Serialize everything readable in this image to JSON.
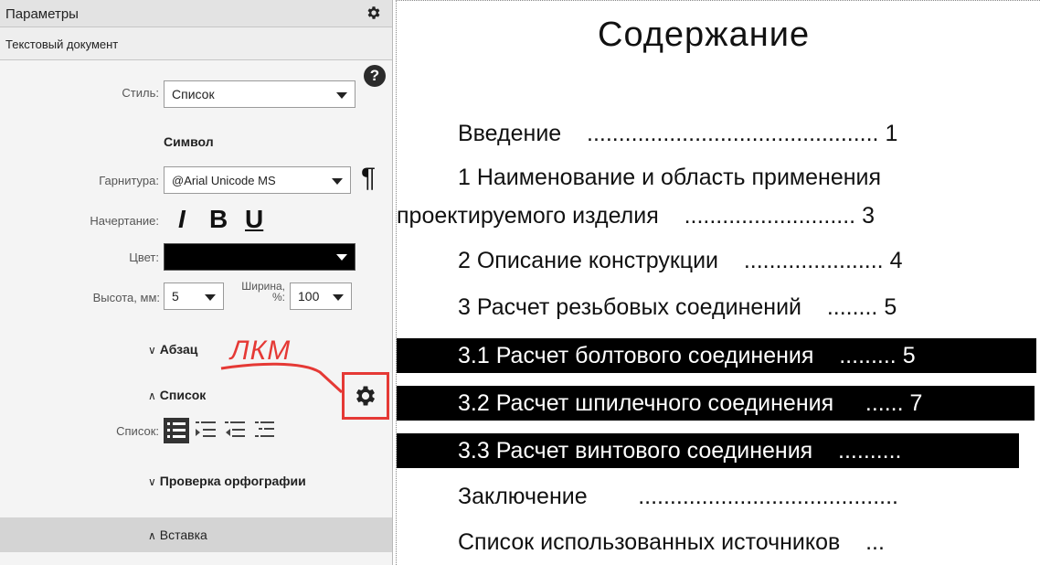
{
  "panel": {
    "title": "Параметры",
    "subtitle": "Текстовый документ",
    "help_label": "?",
    "style_label": "Стиль:",
    "style_value": "Список",
    "symbol_section": "Символ",
    "font_label": "Гарнитура:",
    "font_value": "@Arial Unicode MS",
    "paragraph_mark": "¶",
    "style_face_label": "Начертание:",
    "italic_label": "I",
    "bold_label": "B",
    "underline_label": "U",
    "color_label": "Цвет:",
    "color_value": "#000000",
    "height_label": "Высота, мм:",
    "height_value": "5",
    "width_label": "Ширина, %:",
    "width_value": "100",
    "sections": {
      "paragraph": "Абзац",
      "list": "Список",
      "spelling": "Проверка орфографии",
      "insert": "Вставка"
    },
    "list_label": "Список:",
    "annotation": "ЛКМ",
    "annotation_color": "#e53935"
  },
  "document": {
    "title": "Содержание",
    "toc": [
      {
        "text": "Введение",
        "leader": "..............................................",
        "page": "1",
        "highlighted": false
      },
      {
        "text": "1 Наименование и область применения",
        "leader": "",
        "page": "",
        "highlighted": false
      },
      {
        "text": "проектируемого изделия",
        "leader": "...........................",
        "page": "3",
        "highlighted": false
      },
      {
        "text": "2 Описание конструкции",
        "leader": "......................",
        "page": "4",
        "highlighted": false
      },
      {
        "text": "3 Расчет резьбовых соединений",
        "leader": "........",
        "page": "5",
        "highlighted": false
      },
      {
        "text": "3.1 Расчет болтового соединения",
        "leader": ".........",
        "page": "5",
        "highlighted": true
      },
      {
        "text": "3.2 Расчет шпилечного соединения",
        "leader": "......",
        "page": "7",
        "highlighted": true
      },
      {
        "text": "3.3 Расчет винтового соединения",
        "leader": "..........",
        "page": "",
        "highlighted": true
      },
      {
        "text": "Заключение",
        "leader": ".........................................",
        "page": "",
        "highlighted": false
      },
      {
        "text": "Список использованных источников",
        "leader": "...",
        "page": "",
        "highlighted": false
      }
    ]
  }
}
